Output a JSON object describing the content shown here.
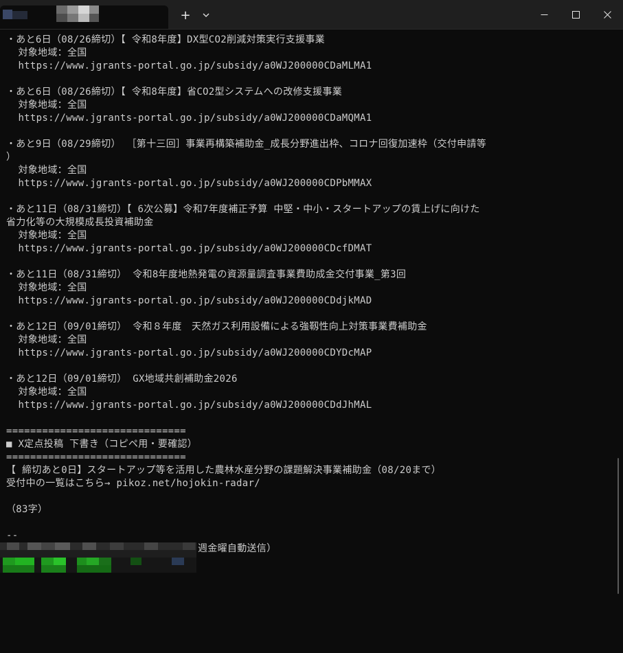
{
  "titlebar": {
    "new_tab_label": "+",
    "dropdown_label": "⌄",
    "minimize_label": "─",
    "maximize_label": "☐",
    "close_label": "✕"
  },
  "entries": [
    {
      "head": "・あと6日（08/26締切）【 令和8年度】DX型CO2削減対策実行支援事業",
      "cont": "",
      "region": "  対象地域：全国",
      "url": "  https://www.jgrants-portal.go.jp/subsidy/a0WJ200000CDaMLMA1"
    },
    {
      "head": "・あと6日（08/26締切）【 令和8年度】省CO2型システムへの改修支援事業",
      "cont": "",
      "region": "  対象地域：全国",
      "url": "  https://www.jgrants-portal.go.jp/subsidy/a0WJ200000CDaMQMA1"
    },
    {
      "head": "・あと9日（08/29締切） ［第十三回］事業再構築補助金_成長分野進出枠、コロナ回復加速枠（交付申請等",
      "cont": "）",
      "region": "  対象地域：全国",
      "url": "  https://www.jgrants-portal.go.jp/subsidy/a0WJ200000CDPbMMAX"
    },
    {
      "head": "・あと11日（08/31締切）【 6次公募】令和7年度補正予算 中堅・中小・スタートアップの賃上げに向けた",
      "cont": "省力化等の大規模成長投資補助金",
      "region": "  対象地域：全国",
      "url": "  https://www.jgrants-portal.go.jp/subsidy/a0WJ200000CDcfDMAT"
    },
    {
      "head": "・あと11日（08/31締切） 令和8年度地熱発電の資源量調査事業費助成金交付事業_第3回",
      "cont": "",
      "region": "  対象地域：全国",
      "url": "  https://www.jgrants-portal.go.jp/subsidy/a0WJ200000CDdjkMAD"
    },
    {
      "head": "・あと12日（09/01締切） 令和８年度　天然ガス利用設備による強靱性向上対策事業費補助金",
      "cont": "",
      "region": "  対象地域：全国",
      "url": "  https://www.jgrants-portal.go.jp/subsidy/a0WJ200000CDYDcMAP"
    },
    {
      "head": "・あと12日（09/01締切） GX地域共創補助金2026",
      "cont": "",
      "region": "  対象地域：全国",
      "url": "  https://www.jgrants-portal.go.jp/subsidy/a0WJ200000CDdJhMAL"
    }
  ],
  "footer": {
    "sep1": "==============================",
    "heading": "■ X定点投稿 下書き（コピペ用・要確認）",
    "sep2": "==============================",
    "post_line1": "【 締切あと0日】スタートアップ等を活用した農林水産分野の課題解決事業補助金（08/20まで）",
    "post_line2": "受付中の一覧はこちら→ pikoz.net/hojokin-radar/",
    "char_count": "（83字）",
    "dash": "--",
    "signature_tail": "週金曜自動送信）"
  }
}
